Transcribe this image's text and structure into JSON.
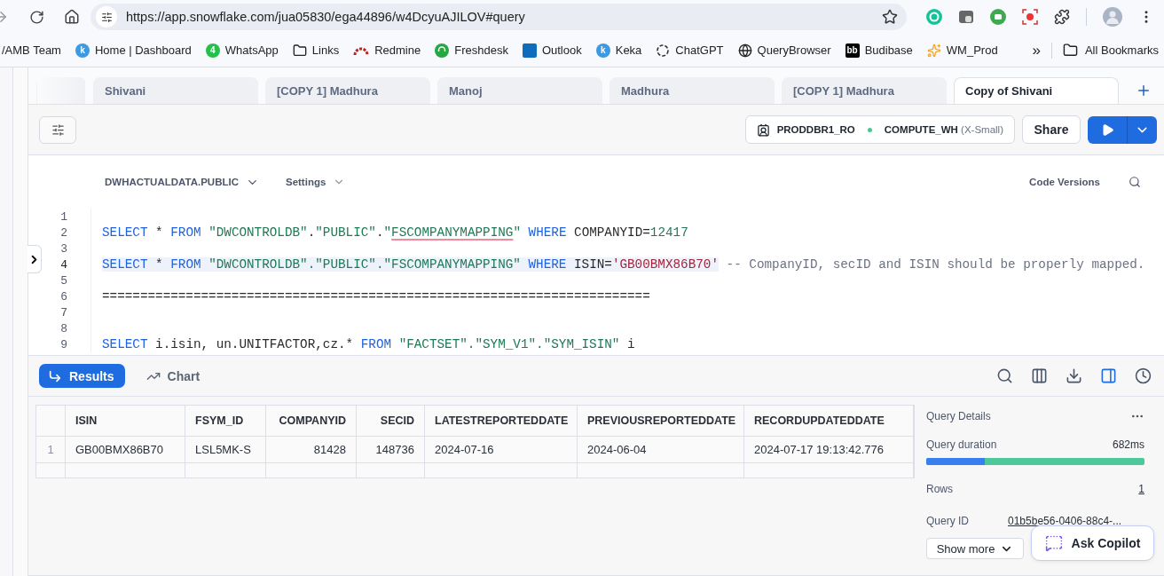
{
  "browser": {
    "url": "https://app.snowflake.com/jua05830/ega44896/w4DcyuAJILOV#query",
    "bookmarks": [
      {
        "label": "/AMB Team",
        "kind": "plain"
      },
      {
        "label": "Home | Dashboard",
        "kind": "badge",
        "color": "#3b9ae1",
        "glyph": "k"
      },
      {
        "label": "WhatsApp",
        "kind": "badge",
        "color": "#25c04a",
        "glyph": "4"
      },
      {
        "label": "Links",
        "kind": "folder"
      },
      {
        "label": "Redmine",
        "kind": "arcs",
        "color": "#c0201f"
      },
      {
        "label": "Freshdesk",
        "kind": "dot",
        "color": "#25a844"
      },
      {
        "label": "Outlook",
        "kind": "tile",
        "color": "#0f6cbd"
      },
      {
        "label": "Keka",
        "kind": "badge",
        "color": "#3b9ae1",
        "glyph": "k"
      },
      {
        "label": "ChatGPT",
        "kind": "swirl"
      },
      {
        "label": "QueryBrowser",
        "kind": "globe"
      },
      {
        "label": "Budibase",
        "kind": "tile",
        "color": "#000000",
        "glyph": "bb"
      },
      {
        "label": "WM_Prod",
        "kind": "spark",
        "color": "#f5a623"
      }
    ],
    "overflow": "»",
    "all_bookmarks": "All Bookmarks"
  },
  "worksheet_tabs": [
    {
      "selected": false
    },
    {
      "label": "Shivani",
      "selected": false
    },
    {
      "label": "[COPY 1] Madhura",
      "selected": false
    },
    {
      "label": "Manoj",
      "selected": false
    },
    {
      "label": "Madhura",
      "selected": false
    },
    {
      "label": "[COPY 1] Madhura",
      "selected": false
    },
    {
      "label": "Copy of Shivani",
      "selected": true
    }
  ],
  "context": {
    "role": "PRODDBR1_RO",
    "warehouse": "COMPUTE_WH",
    "size": "(X-Small)"
  },
  "share": "Share",
  "editor": {
    "database": "DWHACTUALDATA.PUBLIC",
    "settings": "Settings",
    "code_versions": "Code Versions",
    "lines": [
      {
        "number": "1",
        "selected": false
      },
      {
        "number": "2",
        "selected": false,
        "tokens": [
          {
            "kind": "kw",
            "text": "SELECT"
          },
          {
            "kind": "txt",
            "text": " * "
          },
          {
            "kind": "kw",
            "text": "FROM"
          },
          {
            "kind": "str",
            "text": " \"DWCONTROLDB\""
          },
          {
            "kind": "txt",
            "text": "."
          },
          {
            "kind": "str",
            "text": "\"PUBLIC\""
          },
          {
            "kind": "txt",
            "text": "."
          },
          {
            "kind": "str",
            "text": "\""
          },
          {
            "kind": "err",
            "text": "FSCOMPANYMAPPING"
          },
          {
            "kind": "str",
            "text": "\""
          },
          {
            "kind": "kw",
            "text": " WHERE"
          },
          {
            "kind": "txt",
            "text": " COMPANYID="
          },
          {
            "kind": "num",
            "text": "12417"
          }
        ]
      },
      {
        "number": "3",
        "selected": false
      },
      {
        "number": "4",
        "selected": true,
        "tokens": [
          {
            "kind": "kw",
            "text": "SELECT"
          },
          {
            "kind": "txt",
            "text": " * "
          },
          {
            "kind": "kw",
            "text": "FROM"
          },
          {
            "kind": "str",
            "text": " \"DWCONTROLDB\".\"PUBLIC\".\"FSCOMPANYMAPPING\""
          },
          {
            "kind": "kw",
            "text": " WHERE"
          },
          {
            "kind": "txt",
            "text": " ISIN="
          },
          {
            "kind": "lit",
            "text": "'GB00BMX86B70'"
          },
          {
            "kind": "cmt",
            "text": " -- CompanyID, secID and ISIN should be properly mapped."
          }
        ]
      },
      {
        "number": "5",
        "selected": false
      },
      {
        "number": "6",
        "selected": false,
        "tokens": [
          {
            "kind": "txt",
            "text": "========================================================================"
          }
        ]
      },
      {
        "number": "7",
        "selected": false
      },
      {
        "number": "8",
        "selected": false
      },
      {
        "number": "9",
        "selected": false,
        "tokens": [
          {
            "kind": "kw",
            "text": "SELECT"
          },
          {
            "kind": "txt",
            "text": " i.isin, un.UNITFACTOR,cz.* "
          },
          {
            "kind": "kw",
            "text": "FROM"
          },
          {
            "kind": "str",
            "text": " \"FACTSET\".\"SYM_V1\".\"SYM_ISIN\""
          },
          {
            "kind": "txt",
            "text": " i"
          }
        ]
      }
    ]
  },
  "results": {
    "tabs": [
      {
        "label": "Results",
        "kind": "results",
        "selected": true
      },
      {
        "label": "Chart",
        "kind": "chart",
        "selected": false
      }
    ],
    "tools": [
      {
        "kind": "search",
        "active": false
      },
      {
        "kind": "columns",
        "active": false
      },
      {
        "kind": "download",
        "active": false
      },
      {
        "kind": "split",
        "active": true
      },
      {
        "kind": "history",
        "active": false
      }
    ],
    "table": {
      "columns": [
        {
          "label": "ISIN",
          "kind": "text"
        },
        {
          "label": "FSYM_ID",
          "kind": "text"
        },
        {
          "label": "COMPANYID",
          "kind": "number"
        },
        {
          "label": "SECID",
          "kind": "number"
        },
        {
          "label": "LATESTREPORTEDDATE",
          "kind": "text"
        },
        {
          "label": "PREVIOUSREPORTEDDATE",
          "kind": "text"
        },
        {
          "label": "RECORDUPDATEDDATE",
          "kind": "text"
        }
      ],
      "rows": [
        {
          "number": "1",
          "cells": [
            "GB00BMX86B70",
            "LSL5MK-S",
            "81428",
            "148736",
            "2024-07-16",
            "2024-06-04",
            "2024-07-17 19:13:42.776"
          ]
        }
      ]
    },
    "details": {
      "title": "Query Details",
      "duration_label": "Query duration",
      "duration": "682ms",
      "level": 0.27,
      "rows_label": "Rows",
      "rows": "1",
      "id_label": "Query ID",
      "id": "01b5be56-0406-88c4-...",
      "show_more": "Show more"
    }
  },
  "copilot": "Ask Copilot"
}
